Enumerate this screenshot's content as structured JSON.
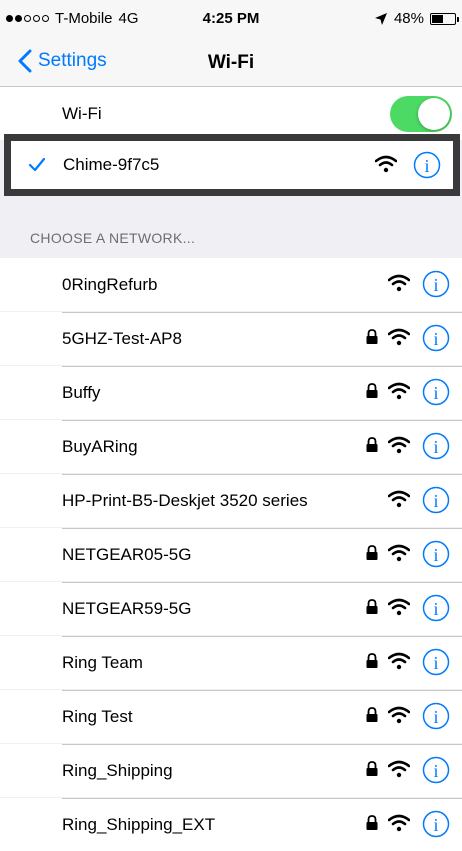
{
  "status": {
    "carrier": "T-Mobile",
    "network": "4G",
    "time": "4:25 PM",
    "battery": "48%",
    "battery_level": 48,
    "signal_bars_filled": 2,
    "signal_bars_total": 5
  },
  "nav": {
    "back_label": "Settings",
    "title": "Wi-Fi"
  },
  "wifi_toggle": {
    "label": "Wi-Fi",
    "on": true
  },
  "connected": {
    "name": "Chime-9f7c5"
  },
  "section_header": "CHOOSE A NETWORK...",
  "networks": [
    {
      "name": "0RingRefurb",
      "locked": false
    },
    {
      "name": "5GHZ-Test-AP8",
      "locked": true
    },
    {
      "name": "Buffy",
      "locked": true
    },
    {
      "name": "BuyARing",
      "locked": true
    },
    {
      "name": "HP-Print-B5-Deskjet 3520 series",
      "locked": false
    },
    {
      "name": "NETGEAR05-5G",
      "locked": true
    },
    {
      "name": "NETGEAR59-5G",
      "locked": true
    },
    {
      "name": "Ring Team",
      "locked": true
    },
    {
      "name": "Ring Test",
      "locked": true
    },
    {
      "name": "Ring_Shipping",
      "locked": true
    },
    {
      "name": "Ring_Shipping_EXT",
      "locked": true
    }
  ],
  "colors": {
    "accent": "#007aff",
    "toggle_on": "#4cd964",
    "highlight_border": "#3a3a3a"
  }
}
